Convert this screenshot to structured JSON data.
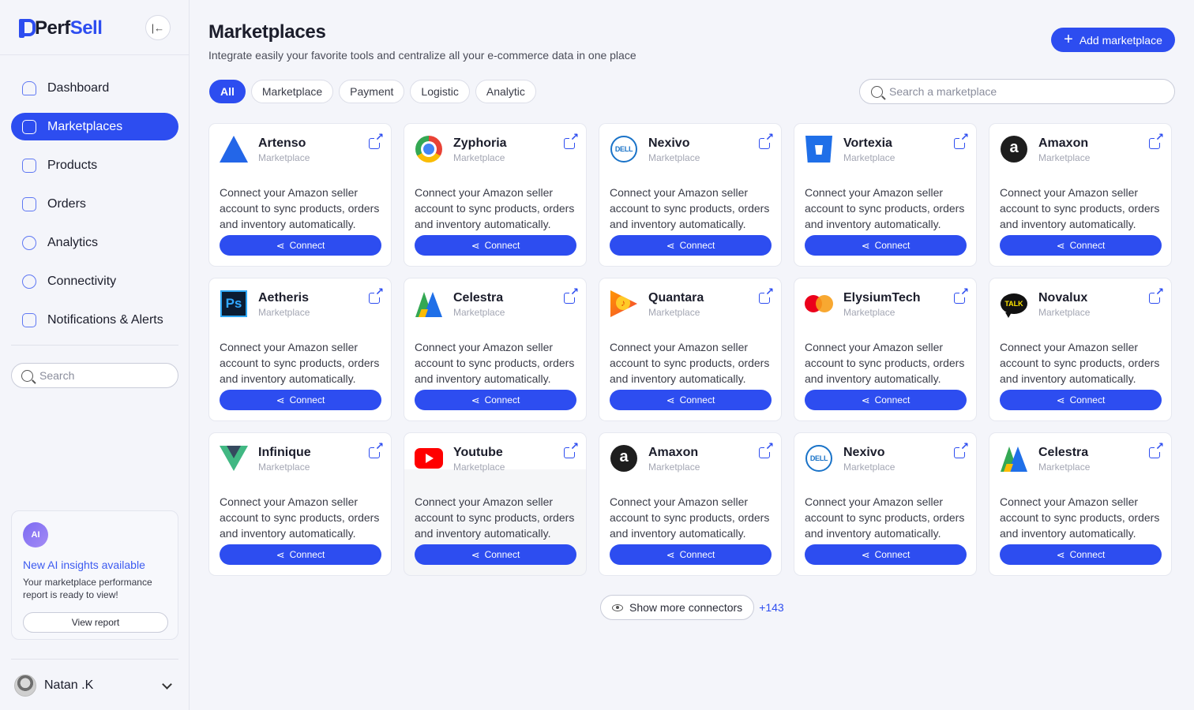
{
  "brand": {
    "name_part1": "Perf",
    "name_part2": "Sell"
  },
  "sidebar": {
    "collapse_icon": "collapse-left-icon",
    "nav": [
      {
        "label": "Dashboard",
        "icon": "home-icon",
        "active": false
      },
      {
        "label": "Marketplaces",
        "icon": "store-icon",
        "active": true
      },
      {
        "label": "Products",
        "icon": "products-icon",
        "active": false
      },
      {
        "label": "Orders",
        "icon": "cart-icon",
        "active": false
      },
      {
        "label": "Analytics",
        "icon": "pie-chart-icon",
        "active": false
      },
      {
        "label": "Connectivity",
        "icon": "cloud-icon",
        "active": false
      },
      {
        "label": "Notifications & Alerts",
        "icon": "bell-icon",
        "active": false
      }
    ],
    "search_placeholder": "Search",
    "ai": {
      "badge": "AI",
      "title": "New AI insights available",
      "description": "Your marketplace performance report is ready to view!",
      "button": "View report"
    },
    "user": {
      "name": "Natan .K"
    }
  },
  "header": {
    "title": "Marketplaces",
    "subtitle": "Integrate easily your favorite tools and centralize all your e-commerce data in one place",
    "add_button": "Add marketplace"
  },
  "filters": [
    "All",
    "Marketplace",
    "Payment",
    "Logistic",
    "Analytic"
  ],
  "active_filter": "All",
  "marketplace_search_placeholder": "Search a marketplace",
  "card_description": "Connect your Amazon seller account to sync  products, orders and inventory automatically.",
  "connect_label": "Connect",
  "cards": [
    {
      "name": "Artenso",
      "type": "Marketplace",
      "logo": "artenso"
    },
    {
      "name": "Zyphoria",
      "type": "Marketplace",
      "logo": "chrome"
    },
    {
      "name": "Nexivo",
      "type": "Marketplace",
      "logo": "dell"
    },
    {
      "name": "Vortexia",
      "type": "Marketplace",
      "logo": "vortexia"
    },
    {
      "name": "Amaxon",
      "type": "Marketplace",
      "logo": "amazon"
    },
    {
      "name": "Aetheris",
      "type": "Marketplace",
      "logo": "ps"
    },
    {
      "name": "Celestra",
      "type": "Marketplace",
      "logo": "celestra"
    },
    {
      "name": "Quantara",
      "type": "Marketplace",
      "logo": "gplay"
    },
    {
      "name": "ElysiumTech",
      "type": "Marketplace",
      "logo": "master"
    },
    {
      "name": "Novalux",
      "type": "Marketplace",
      "logo": "talk"
    },
    {
      "name": "Infinique",
      "type": "Marketplace",
      "logo": "vue"
    },
    {
      "name": "Youtube",
      "type": "Marketplace",
      "logo": "yt",
      "hover": true
    },
    {
      "name": "Amaxon",
      "type": "Marketplace",
      "logo": "amazon"
    },
    {
      "name": "Nexivo",
      "type": "Marketplace",
      "logo": "dell"
    },
    {
      "name": "Celestra",
      "type": "Marketplace",
      "logo": "celestra"
    }
  ],
  "logo_text": {
    "dell": "DELL",
    "amazon": "a",
    "ps": "Ps",
    "talk": "TALK"
  },
  "show_more": {
    "label": "Show more connectors",
    "count": "+143"
  }
}
